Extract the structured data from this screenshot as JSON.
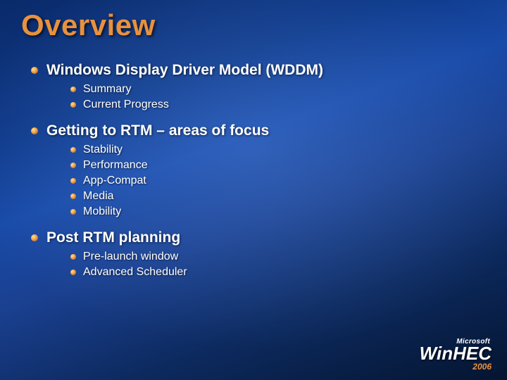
{
  "title": "Overview",
  "sections": [
    {
      "heading": "Windows Display Driver Model (WDDM)",
      "items": [
        "Summary",
        "Current Progress"
      ]
    },
    {
      "heading": "Getting to RTM – areas of focus",
      "items": [
        "Stability",
        "Performance",
        "App-Compat",
        "Media",
        "Mobility"
      ]
    },
    {
      "heading": "Post RTM planning",
      "items": [
        "Pre-launch window",
        "Advanced Scheduler"
      ]
    }
  ],
  "logo": {
    "brand_prefix": "Microsoft",
    "brand_main": "Win",
    "brand_suffix": "HEC",
    "year": "2006"
  }
}
